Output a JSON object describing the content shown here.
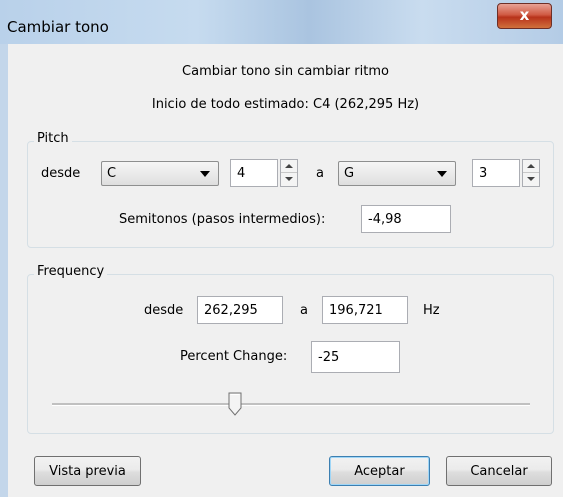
{
  "window": {
    "title": "Cambiar tono",
    "close_label": "x"
  },
  "header": {
    "subtitle": "Cambiar tono sin cambiar ritmo",
    "estimate": "Inicio de todo estimado: C4 (262,295 Hz)"
  },
  "pitch": {
    "group_label": "Pitch",
    "from_label": "desde",
    "from_note": "C",
    "from_octave": "4",
    "to_label": "a",
    "to_note": "G",
    "to_octave": "3",
    "semitones_label": "Semitonos (pasos intermedios):",
    "semitones_value": "-4,98"
  },
  "frequency": {
    "group_label": "Frequency",
    "from_label": "desde",
    "from_value": "262,295",
    "to_label": "a",
    "to_value": "196,721",
    "unit": "Hz",
    "percent_label": "Percent Change:",
    "percent_value": "-25",
    "slider_level_percent": -25
  },
  "buttons": {
    "preview": "Vista previa",
    "ok": "Aceptar",
    "cancel": "Cancelar"
  },
  "colors": {
    "titlebar": "#b9d1ea",
    "close_button": "#c8462c",
    "client": "#f0f0f0"
  },
  "icons": [
    "close-icon",
    "dropdown-arrow-icon",
    "spin-up-icon",
    "spin-down-icon",
    "slider-thumb"
  ]
}
